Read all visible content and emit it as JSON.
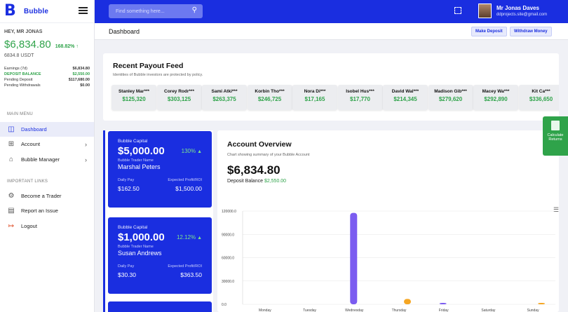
{
  "brand": {
    "name": "Bubble",
    "logo": "B"
  },
  "sidebar": {
    "greeting": "HEY, MR JONAS",
    "balance": "$6,834.80",
    "balance_change": "168.82% ↑",
    "balance_usdt": "6834.8 USDT",
    "stats": [
      {
        "label": "Earnings (7d)",
        "value": "$6,834.80",
        "highlight": false
      },
      {
        "label": "DEPOSIT BALANCE",
        "value": "$2,550.00",
        "highlight": true
      },
      {
        "label": "Pending Deposit",
        "value": "$117,680.00",
        "highlight": false
      },
      {
        "label": "Pending Withdrawals",
        "value": "$0.00",
        "highlight": false
      }
    ],
    "main_menu_label": "MAIN MENU",
    "main_menu": [
      {
        "label": "Dashboard",
        "icon": "dashboard-icon",
        "glyph": "◫",
        "active": true,
        "chevron": false
      },
      {
        "label": "Account",
        "icon": "grid-icon",
        "glyph": "⊞",
        "active": false,
        "chevron": true
      },
      {
        "label": "Bubble Manager",
        "icon": "home-icon",
        "glyph": "⌂",
        "active": false,
        "chevron": true
      }
    ],
    "links_label": "IMPORTANT LINKS",
    "links": [
      {
        "label": "Become a Trader",
        "icon": "gear-icon",
        "glyph": "⚙"
      },
      {
        "label": "Report an Issue",
        "icon": "document-icon",
        "glyph": "▤"
      },
      {
        "label": "Logout",
        "icon": "logout-icon",
        "glyph": "↦"
      }
    ]
  },
  "header": {
    "search_placeholder": "Find something here...",
    "user_name": "Mr Jonas Daves",
    "user_email": "ddprojects.site@gmail.com"
  },
  "subheader": {
    "title": "Dashboard",
    "make_deposit": "Make Deposit",
    "withdraw_money": "Withdraw Money"
  },
  "payout_feed": {
    "title": "Recent Payout Feed",
    "subtitle": "Identities of Bubble investors are protected by policy.",
    "items": [
      {
        "name": "Stanley Mar***",
        "amount": "$125,320"
      },
      {
        "name": "Corey Rodr***",
        "amount": "$303,125"
      },
      {
        "name": "Sami Atki***",
        "amount": "$263,375"
      },
      {
        "name": "Korbin Tho***",
        "amount": "$246,725"
      },
      {
        "name": "Nora Di***",
        "amount": "$17,165"
      },
      {
        "name": "Isobel Hus***",
        "amount": "$17,770"
      },
      {
        "name": "David Wal***",
        "amount": "$214,345"
      },
      {
        "name": "Madison Gib***",
        "amount": "$279,620"
      },
      {
        "name": "Macey Wa***",
        "amount": "$292,890"
      },
      {
        "name": "Kit Ca***",
        "amount": "$336,650"
      }
    ]
  },
  "traders": [
    {
      "label": "Bubble Capital",
      "amount": "$5,000.00",
      "pct": "130%",
      "name_label": "Bubble Trader Name",
      "name": "Marshal Peters",
      "daily_label": "Daily Pay",
      "roi_label": "Expected Profit/ROI",
      "daily": "$162.50",
      "roi": "$1,500.00"
    },
    {
      "label": "Bubble Capital",
      "amount": "$1,000.00",
      "pct": "12.12%",
      "name_label": "Bubble Trader Name",
      "name": "Susan Andrews",
      "daily_label": "Daily Pay",
      "roi_label": "Expected Profit/ROI",
      "daily": "$30.30",
      "roi": "$363.50"
    }
  ],
  "overview": {
    "title": "Account Overview",
    "subtitle": "Chart showing summary of your Bubble Account",
    "amount": "$6,834.80",
    "deposit_label": "Deposit Balance",
    "deposit_value": "$2,550.00"
  },
  "calculate_returns": {
    "label": "Calculate Returns"
  },
  "chart_data": {
    "type": "bar",
    "categories": [
      "Monday",
      "Tuesday",
      "Wednesday",
      "Thursday",
      "Friday",
      "Saturday",
      "Sunday"
    ],
    "ylim": [
      0,
      120000
    ],
    "yticks": [
      "0.0",
      "30000.0",
      "60000.0",
      "90000.0",
      "120000.0"
    ],
    "series": [
      {
        "color": "#7b5cf0",
        "values": [
          0,
          0,
          117680,
          0,
          300,
          0,
          0
        ]
      },
      {
        "color": "#f5a623",
        "values": [
          0,
          0,
          0,
          6834.8,
          0,
          0,
          900
        ]
      }
    ]
  }
}
